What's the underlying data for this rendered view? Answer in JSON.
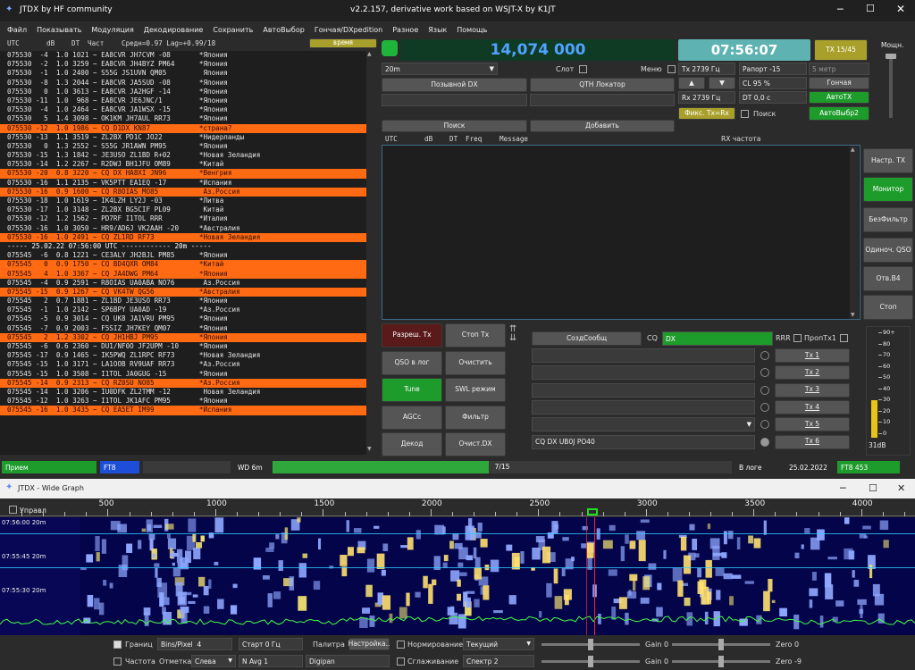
{
  "window": {
    "title": "JTDX  by HF community",
    "subtitle": "v2.2.157, derivative work based on WSJT-X by K1JT"
  },
  "menu": [
    "Файл",
    "Показывать",
    "Модуляция",
    "Декодирование",
    "Сохранить",
    "АвтоВыбор",
    "Гончая/DXpedition",
    "Разное",
    "Язык",
    "Помощь"
  ],
  "band_header": {
    "utc": "UTC",
    "db": "dB",
    "dt": "DT",
    "freq": "Част",
    "avg": "Средн=0.97 Lag=+0.99/18",
    "time_btn": "время"
  },
  "decodes": [
    {
      "t": "075530  -4  1.0 1021 ~ EA8CVR JH7CVM -08       *Япония",
      "hl": false
    },
    {
      "t": "075530  -2  1.0 3259 ~ EA8CVR JH4BYZ PM64      *Япония",
      "hl": false
    },
    {
      "t": "075530  -1  1.0 2400 ~ S55G JS1UVN QM05         Япония",
      "hl": false
    },
    {
      "t": "075530  -8  1.3 2044 ~ EA8CVR JA5SUD -08       *Япония",
      "hl": false
    },
    {
      "t": "075530   0  1.0 3613 ~ EA8CVR JA2HGF -14       *Япония",
      "hl": false
    },
    {
      "t": "075530 -11  1.0  968 ~ EA8CVR JE6JNC/1         *Япония",
      "hl": false
    },
    {
      "t": "075530  -4  1.0 2464 ~ EA8CVR JA1WSX -15       *Япония",
      "hl": false
    },
    {
      "t": "075530   5  1.4 3098 ~ OK1KM JH7AUL RR73       *Япония",
      "hl": false
    },
    {
      "t": "075530 -12  1.0 1986 ~ CQ D1DX KN87            *страна?",
      "hl": true
    },
    {
      "t": "075530 -13  1.1 3519 ~ ZL2BX PD1C JO22         *Нидерланды",
      "hl": false
    },
    {
      "t": "075530   0  1.3 2552 ~ S55G JR1AWN PM95        *Япония",
      "hl": false
    },
    {
      "t": "075530 -15  1.3 1842 ~ JE3USO ZL1BD R+02       *Новая Зеландия",
      "hl": false
    },
    {
      "t": "075530 -14  1.2 2267 ~ R2DWJ BH1JFU OM89       *Китай",
      "hl": false
    },
    {
      "t": "075530 -20  0.8 3220 ~ CQ DX HA8XI JN96        *Венгрия",
      "hl": true
    },
    {
      "t": "075530 -16  1.1 2135 ~ VK5PTT EA1EQ -17        *Испания",
      "hl": false
    },
    {
      "t": "075530 -16  0.9 1600 ~ CQ R8OIAS MO85           Аз.Россия",
      "hl": true
    },
    {
      "t": "075530 -18  1.0 1619 ~ IK4LZH LY2J -03         *Литва",
      "hl": false
    },
    {
      "t": "075530 -17  1.0 3148 ~ ZL2BX BG5CIF PL09        Китай",
      "hl": false
    },
    {
      "t": "075530 -12  1.2 1562 ~ PD7RF I1TOL RRR         *Италия",
      "hl": false
    },
    {
      "t": "075530 -16  1.0 3050 ~ HR9/AD6J VK2AAH -20     *Австралия",
      "hl": false
    },
    {
      "t": "075530 -16  1.0 2491 ~ CQ ZL1RD RF73           *Новая Зеландия",
      "hl": true
    },
    {
      "t": "----- 25.02.22 07:56:00 UTC ------------ 20m -----",
      "hl": false,
      "sep": true
    },
    {
      "t": "075545  -6  0.8 1221 ~ CE3ALY JH2BJL PM85      *Япония",
      "hl": false
    },
    {
      "t": "075545   0  0.9 1750 ~ CQ BD4QXR OM84          *Китай",
      "hl": true
    },
    {
      "t": "075545   4  1.0 3367 ~ CQ JA4DWG PM64          *Япония",
      "hl": true
    },
    {
      "t": "075545  -4  0.9 2591 ~ R8OIAS UA0ABA NO76       Аз.Россия",
      "hl": false
    },
    {
      "t": "075545 -15  0.9 1267 ~ CQ VK4TW QG56           *Австралия",
      "hl": true
    },
    {
      "t": "075545   2  0.7 1881 ~ ZL1BD JE3USO RR73       *Япония",
      "hl": false
    },
    {
      "t": "075545  -1  1.0 2142 ~ SP6BPY UA0AD -19        *Аз.Россия",
      "hl": false
    },
    {
      "t": "075545  -5  0.9 3014 ~ CQ UK8 JA1VRU PM95      *Япония",
      "hl": false
    },
    {
      "t": "075545  -7  0.9 2003 ~ F5SIZ JH7KEY QM07       *Япония",
      "hl": false
    },
    {
      "t": "075545   2  1.2 3302 ~ CQ JH1HBJ PM95          *Япония",
      "hl": true
    },
    {
      "t": "075545  -6  0.6 2360 ~ DU1/NF0O JF2UPM -10     *Япония",
      "hl": false
    },
    {
      "t": "075545 -17  0.9 1465 ~ IK5PWQ ZL1RPC RF73      *Новая Зеландия",
      "hl": false
    },
    {
      "t": "075545 -15  1.0 3171 ~ LA1OOB RV9UAF RR73      *Аз.Россия",
      "hl": false
    },
    {
      "t": "075545 -15  1.0 3508 ~ I1TOL JA0GUG -15        *Япония",
      "hl": false
    },
    {
      "t": "075545 -14  0.9 2313 ~ CQ RZ0SU NO85           *Аз.Россия",
      "hl": true
    },
    {
      "t": "075545 -14  1.0 3206 ~ IU0DFK ZL2TMM -12        Новая Зеландия",
      "hl": false
    },
    {
      "t": "075545 -12  1.0 3263 ~ I1TOL JK1AFC PM95       *Япония",
      "hl": false
    },
    {
      "t": "075545 -16  1.0 3435 ~ CQ EA5ET IM99           *Испания",
      "hl": true
    }
  ],
  "right": {
    "frequency": "14,074 000",
    "clock": "07:56:07",
    "tx_label": "TX 15/45",
    "power_label": "Мощн.",
    "band": "20m",
    "slot_label": "Слот",
    "menu_label": "Меню",
    "tx_hz": "Tx  2739  Гц",
    "rx_hz": "Rx  2739  Гц",
    "report": "Рапорт -15",
    "five_meter": "5 метр",
    "cl": "CL  95 %",
    "dt": "DT 0,0 с",
    "hound_btn": "Гончая",
    "autotx_btn": "АвтоТХ",
    "autosel2_btn": "АвтоВыбр2",
    "fix_btn": "Фикс. Тх=Rx",
    "search_label": "Поиск",
    "dx_call_btn": "Позывной DX",
    "qth_btn": "QTH Локатор",
    "search_btn": "Поиск",
    "add_btn": "Добавить",
    "rx_header": {
      "utc": "UTC",
      "db": "dB",
      "dt": "DT",
      "freq": "Freq",
      "msg": "Message",
      "rxfreq": "RX частота"
    },
    "side": [
      "Настр. TX",
      "Монитор",
      "БезФильтр",
      "Одиноч. QSO",
      "Отв.B4",
      "Стоп"
    ],
    "controls": [
      "Разреш. Тх",
      "Стоп Тх",
      "QSO в лог",
      "Очистить",
      "Tune",
      "SWL режим",
      "AGCc",
      "Фильтр",
      "Декод",
      "Очист.DX"
    ],
    "gen_btn": "СоздСообщ",
    "cq_label": "CQ",
    "cq_value": "DX",
    "rrr_label": "RRR",
    "skip_label": "ПропTx1",
    "tx_msg6": "CQ DX UB0J PO40",
    "tx_buttons": [
      "Tx 1",
      "Tx 2",
      "Tx 3",
      "Tx 4",
      "Tx 5",
      "Tx 6"
    ],
    "meter_ticks": [
      "90+",
      "80",
      "70",
      "60",
      "50",
      "40",
      "30",
      "20",
      "10",
      "0"
    ],
    "meter_value": "31dB"
  },
  "status": {
    "mode": "Прием",
    "ft8": "FT8",
    "wd": "WD 6m",
    "progress": "7/15",
    "progress_fraction": 0.47,
    "inlog": "В логе",
    "date": "25.02.2022",
    "ft8_count": "FT8  453"
  },
  "wide": {
    "title": "JTDX - Wide Graph",
    "control_label": "Управл",
    "ticks": [
      "500",
      "1000",
      "1500",
      "2000",
      "2500",
      "3000",
      "3500",
      "4000"
    ],
    "labels": [
      {
        "time": "07:56:00",
        "band": "20m"
      },
      {
        "time": "07:55:45",
        "band": "20m"
      },
      {
        "time": "07:55:30",
        "band": "20m"
      }
    ],
    "bottom": {
      "bounds": "Границ",
      "bins": "Bins/Pixel",
      "bins_val": "4",
      "start": "Старт 0 Гц",
      "palette": "Палитра",
      "palette_val": "Настройка..",
      "norm": "Нормирование",
      "current": "Текущий",
      "gain0": "Gain 0",
      "zero0": "Zero 0",
      "freq": "Частота",
      "mark": "Отметка",
      "left": "Слева",
      "navg": "N Avg 1",
      "digipan": "Digipan",
      "smooth": "Сглаживание",
      "spectrum": "Спектр 2",
      "gain1": "Gain 0",
      "zero1": "Zero -9"
    }
  }
}
